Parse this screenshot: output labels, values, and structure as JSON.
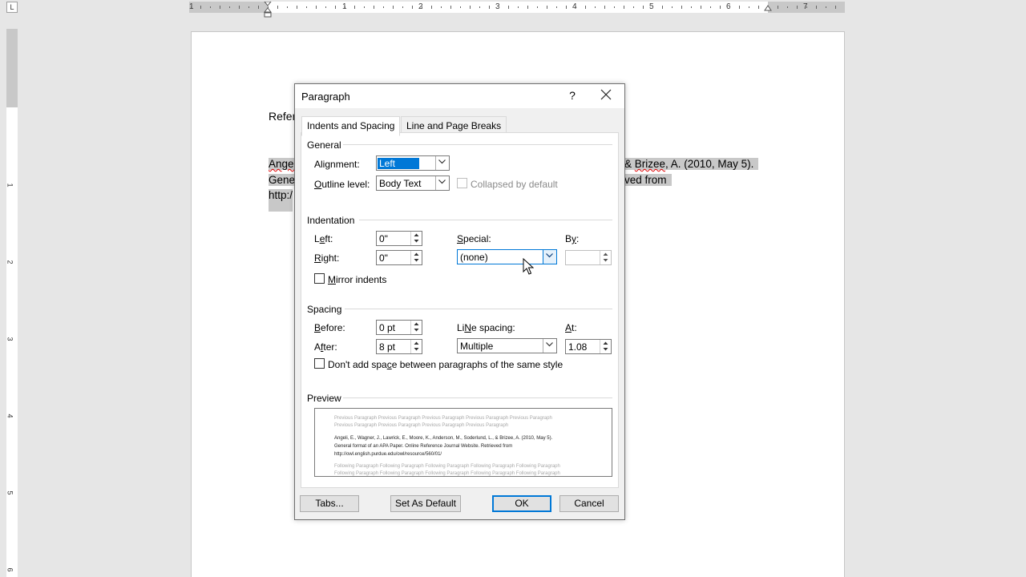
{
  "ruler": {
    "corner_glyph": "L",
    "h_numbers": [
      "1",
      "1",
      "2",
      "3",
      "4",
      "5",
      "6",
      "7"
    ],
    "v_numbers": [
      "1",
      "1",
      "2",
      "3",
      "4",
      "5",
      "6"
    ]
  },
  "document": {
    "heading": "Refer",
    "line1_left": "Angel",
    "line1_right_prefix": "& ",
    "line1_right_squiggle": "Brizee",
    "line1_right_rest": ", A. (2010, May 5).",
    "line2_left": "Gene",
    "line2_right": "ved from",
    "line3_left": "http:/"
  },
  "dialog": {
    "title": "Paragraph",
    "help": "?",
    "tabs": [
      {
        "label": "Indents and Spacing",
        "active": true
      },
      {
        "label": "Line and Page Breaks",
        "active": false
      }
    ],
    "general": {
      "section": "General",
      "alignment_label_pre": "Ali",
      "alignment_label_ul": "g",
      "alignment_label_post": "nment:",
      "alignment_value": "Left",
      "outline_label_ul": "O",
      "outline_label_post": "utline level:",
      "outline_value": "Body Text",
      "collapsed_label": "Collapsed by default"
    },
    "indentation": {
      "section": "Indentation",
      "left_label_pre": "L",
      "left_label_ul": "e",
      "left_label_post": "ft:",
      "left_value": "0\"",
      "right_label_ul": "R",
      "right_label_post": "ight:",
      "right_value": "0\"",
      "special_label_ul": "S",
      "special_label_post": "pecial:",
      "special_value": "(none)",
      "by_label_pre": "B",
      "by_label_ul": "y",
      "by_label_post": ":",
      "by_value": "",
      "mirror_label_ul": "M",
      "mirror_label_post": "irror indents"
    },
    "spacing": {
      "section": "Spacing",
      "before_label_ul": "B",
      "before_label_post": "efore:",
      "before_value": "0 pt",
      "after_label_ul": "f",
      "after_label_pre": "A",
      "after_label_post": "ter:",
      "after_value": "8 pt",
      "line_spacing_label_ul": "N",
      "line_spacing_label_pre": "Li",
      "line_spacing_label_post": "e spacing:",
      "line_spacing_value": "Multiple",
      "at_label_ul": "A",
      "at_label_post": "t:",
      "at_value": "1.08",
      "dont_add_pre": "Don't add spa",
      "dont_add_ul": "c",
      "dont_add_post": "e between paragraphs of the same style"
    },
    "preview": {
      "section": "Preview",
      "prev_line1": "Previous Paragraph Previous Paragraph Previous Paragraph Previous Paragraph Previous Paragraph",
      "prev_line2": "Previous Paragraph Previous Paragraph Previous Paragraph Previous Paragraph",
      "text_line1": "Angeli, E., Wagner, J., Lawrick, E., Moore, K., Anderson, M., Soderlund, L., & Brizee, A. (2010, May 5).",
      "text_line2": "General format of an APA Paper. Online Reference Journal Website. Retrieved from",
      "text_line3": "http://owl.english.purdue.edu/owl/resource/560/01/",
      "follow_line1": "Following Paragraph Following Paragraph Following Paragraph Following Paragraph Following Paragraph",
      "follow_line2": "Following Paragraph Following Paragraph Following Paragraph Following Paragraph Following Paragraph"
    },
    "buttons": {
      "tabs": "Tabs...",
      "set_default": "Set As Default",
      "ok": "OK",
      "cancel": "Cancel"
    }
  },
  "colors": {
    "accent": "#0078d7",
    "dialog_bg": "#f0f0f0",
    "selection": "#c8c8c8"
  }
}
